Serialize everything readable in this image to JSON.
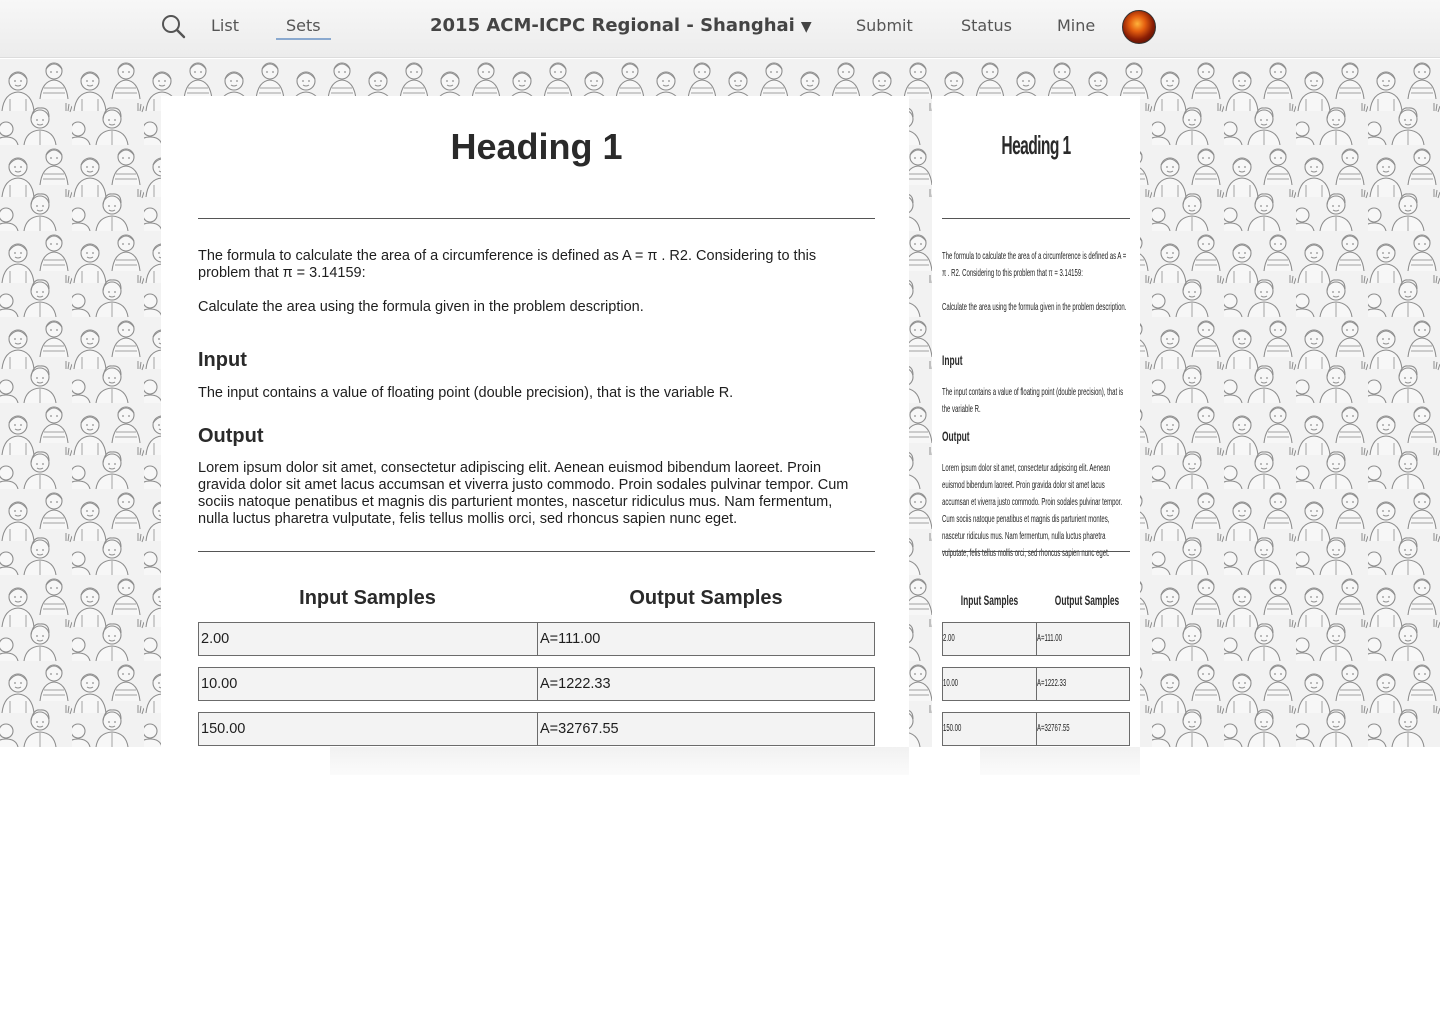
{
  "nav": {
    "links": [
      "List",
      "Sets"
    ],
    "active": "Sets",
    "contest_title": "2015 ACM-ICPC Regional - Shanghai",
    "contest_caret": "▼",
    "right_links": [
      "Submit",
      "Status",
      "Mine"
    ]
  },
  "problem": {
    "heading": "Heading 1",
    "description_1": "The formula to calculate the area of a circumference is defined as A = π . R2. Considering to this problem that π = 3.14159:",
    "description_2": "Calculate the area using the formula given in the problem description.",
    "input_heading": "Input",
    "input_text": "The input contains a value of floating point (double precision), that is the variable R.",
    "output_heading": "Output",
    "output_text": "Lorem ipsum dolor sit amet, consectetur adipiscing elit. Aenean euismod bibendum laoreet. Proin gravida dolor sit amet lacus accumsan et viverra justo commodo. Proin sodales pulvinar tempor. Cum sociis natoque penatibus et magnis dis parturient montes, nascetur ridiculus mus. Nam fermentum, nulla luctus pharetra vulputate, felis tellus mollis orci, sed rhoncus sapien nunc eget.",
    "samples_input_heading": "Input Samples",
    "samples_output_heading": "Output Samples",
    "samples": [
      {
        "input": "2.00",
        "output": "A=111.00"
      },
      {
        "input": "10.00",
        "output": "A=1222.33"
      },
      {
        "input": "150.00",
        "output": "A=32767.55"
      }
    ]
  }
}
